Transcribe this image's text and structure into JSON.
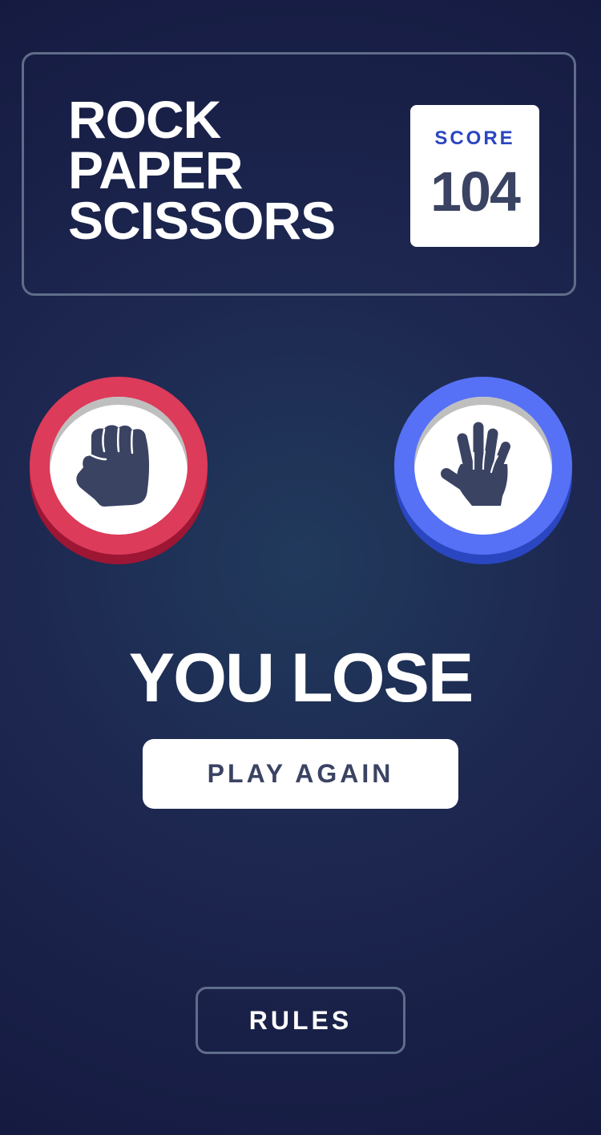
{
  "header": {
    "title_lines": [
      "ROCK",
      "PAPER",
      "SCISSORS"
    ],
    "score_label": "SCORE",
    "score_value": "104"
  },
  "match": {
    "player_pick": "rock",
    "house_pick": "paper",
    "result_text": "YOU LOSE",
    "play_again_label": "PLAY AGAIN"
  },
  "footer": {
    "rules_label": "RULES"
  },
  "icons": {
    "rock": "fist-icon",
    "paper": "open-hand-icon"
  },
  "colors": {
    "background": "#1d2750",
    "rock_ring": "#dc3b5a",
    "paper_ring": "#5671f5",
    "score_label": "#2a46c0",
    "dark_text": "#3b4363",
    "outline": "#5f6d8a"
  }
}
